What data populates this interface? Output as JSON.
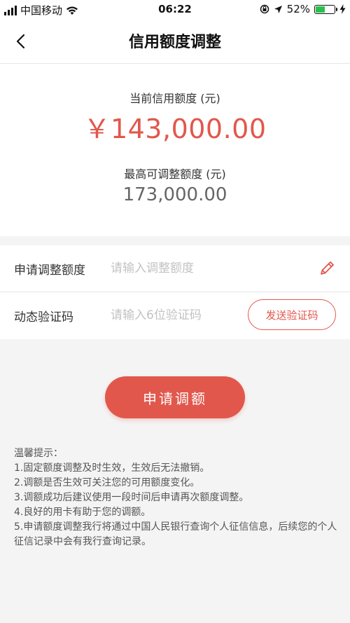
{
  "status_bar": {
    "carrier": "中国移动",
    "time": "06:22",
    "battery_percent": "52%",
    "battery_level": 0.52,
    "battery_color": "#27c24c"
  },
  "nav": {
    "back_icon": "chevron-left-icon",
    "title": "信用额度调整"
  },
  "credit": {
    "current_label": "当前信用额度 (元)",
    "current_amount": "￥143,000.00",
    "max_label": "最高可调整额度 (元)",
    "max_amount": "173,000.00"
  },
  "form": {
    "amount_label": "申请调整额度",
    "amount_placeholder": "请输入调整额度",
    "amount_icon": "pencil-icon",
    "code_label": "动态验证码",
    "code_placeholder": "请输入6位验证码",
    "send_code_label": "发送验证码"
  },
  "apply_button_label": "申请调额",
  "tips": {
    "title": "温馨提示：",
    "items": [
      "1.固定额度调整及时生效，生效后无法撤销。",
      "2.调额是否生效可关注您的可用额度变化。",
      "3.调额成功后建议使用一段时间后申请再次额度调整。",
      "4.良好的用卡有助于您的调额。",
      "5.申请额度调整我行将通过中国人民银行查询个人征信信息，后续您的个人征信记录中会有我行查询记录。"
    ]
  },
  "colors": {
    "accent": "#e2574c",
    "background": "#f4f4f4"
  }
}
